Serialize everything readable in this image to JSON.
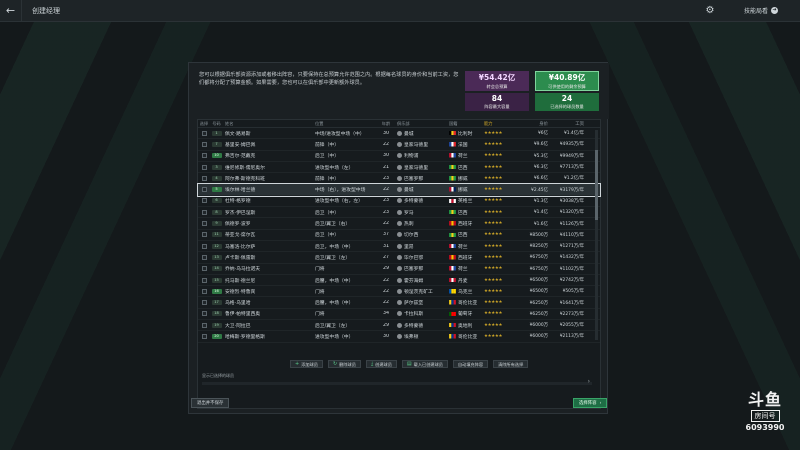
{
  "topbar": {
    "title": "创建经理",
    "link_label": "技能局看",
    "link_icon": "circle-arrow-icon"
  },
  "intro": "您可以根据俱乐部资源添加或者移出阵容，只要保持在总预算允许范围之内。根据每名球员的身价和当前工资，您们都将分配了预算金额。如果需要，您也可以在俱乐部中更新额外球员。",
  "stats": {
    "transfer": {
      "value": "¥54.42亿",
      "label": "转会总预算"
    },
    "wage": {
      "value": "¥40.89亿",
      "label": "可供使用的剩余预算"
    },
    "count1": {
      "value": "84",
      "label": "阵容最大容量"
    },
    "count2": {
      "value": "24",
      "label": "已选择的球员数量"
    }
  },
  "table": {
    "headers": [
      "选择",
      "号码",
      "姓名",
      "位置",
      "年龄",
      "俱乐部",
      "国籍",
      "能力",
      "身价",
      "工资"
    ],
    "rows": [
      {
        "num": "1",
        "name": "佩文·路易斯",
        "pos": "中场/进攻型中场（中）",
        "age": "30",
        "club": "曼城",
        "nat": "比利时",
        "flag": [
          "#000",
          "#f5d11a",
          "#e5262c"
        ],
        "stars": "★★★★★",
        "val": "¥6亿",
        "wage": "¥1.4亿/年"
      },
      {
        "num": "7",
        "name": "基里安·姆巴佩",
        "pos": "前锋（中）",
        "age": "22",
        "club": "皇家马德里",
        "nat": "法国",
        "flag": [
          "#1f4aa8",
          "#fff",
          "#e5262c"
        ],
        "stars": "★★★★★",
        "val": "¥9.6亿",
        "wage": "¥4935万/年"
      },
      {
        "num": "10",
        "name": "弗吉尔·范戴克",
        "pos": "后卫（中）",
        "age": "30",
        "club": "利物浦",
        "nat": "荷兰",
        "flag": [
          "#c8102e",
          "#fff",
          "#1f4aa8"
        ],
        "stars": "★★★★★",
        "val": "¥5.3亿",
        "wage": "¥9949万/年"
      },
      {
        "num": "3",
        "name": "维尼修斯·儒尼奥尔",
        "pos": "进攻型中场（左）",
        "age": "21",
        "club": "皇家马德里",
        "nat": "巴西",
        "flag": [
          "#229e45",
          "#f5d11a",
          "#229e45"
        ],
        "stars": "★★★★★",
        "val": "¥6.3亿",
        "wage": "¥7713万/年"
      },
      {
        "num": "4",
        "name": "阿尔弗·斯德克科班",
        "pos": "前锋（中）",
        "age": "23",
        "club": "巴塞罗那",
        "nat": "挪威",
        "flag": [
          "#229e45",
          "#f5d11a",
          "#229e45"
        ],
        "stars": "★★★★★",
        "val": "¥6.6亿",
        "wage": "¥1.2亿/年"
      },
      {
        "num": "5",
        "name": "埃尔林·哈兰德",
        "pos": "中场（右），进攻型中场",
        "age": "22",
        "club": "曼城",
        "nat": "挪威",
        "flag": [
          "#ba0c2f",
          "#fff",
          "#00205b"
        ],
        "stars": "★★★★★",
        "val": "¥2.45亿",
        "wage": "¥3179万/年"
      },
      {
        "num": "6",
        "name": "杜特·格罗德",
        "pos": "进攻型中场（右，左）",
        "age": "23",
        "club": "多特蒙德",
        "nat": "英格兰",
        "flag": [
          "#fff",
          "#c8102e",
          "#fff"
        ],
        "stars": "★★★★★",
        "val": "¥1.3亿",
        "wage": "¥3038万/年"
      },
      {
        "num": "8",
        "name": "罗杰·伊巴涅斯",
        "pos": "后卫（中）",
        "age": "23",
        "club": "罗马",
        "nat": "巴西",
        "flag": [
          "#229e45",
          "#f5d11a",
          "#229e45"
        ],
        "stars": "★★★★★",
        "val": "¥1.4亿",
        "wage": "¥1320万/年"
      },
      {
        "num": "9",
        "name": "佩德罗·波罗",
        "pos": "后卫/翼卫（右）",
        "age": "22",
        "club": "热刺",
        "nat": "西班牙",
        "flag": [
          "#c60b1e",
          "#ffc400",
          "#c60b1e"
        ],
        "stars": "★★★★★",
        "val": "¥1.6亿",
        "wage": "¥1126万/年"
      },
      {
        "num": "11",
        "name": "蒂亚戈·席尔瓦",
        "pos": "后卫（中）",
        "age": "37",
        "club": "切尔西",
        "nat": "巴西",
        "flag": [
          "#229e45",
          "#f5d11a",
          "#229e45"
        ],
        "stars": "★★★★★",
        "val": "¥8500万",
        "wage": "¥4110万/年"
      },
      {
        "num": "12",
        "name": "马塞洛·比尔萨",
        "pos": "后卫，中场（中）",
        "age": "31",
        "club": "里昂",
        "nat": "荷兰",
        "flag": [
          "#c8102e",
          "#fff",
          "#1f4aa8"
        ],
        "stars": "★★★★★",
        "val": "¥8250万",
        "wage": "¥1271万/年"
      },
      {
        "num": "13",
        "name": "卢卡斯·佩雷斯",
        "pos": "后卫/翼卫（左）",
        "age": "27",
        "club": "毕尔巴鄂",
        "nat": "西班牙",
        "flag": [
          "#c60b1e",
          "#ffc400",
          "#c60b1e"
        ],
        "stars": "★★★★★",
        "val": "¥6750万",
        "wage": "¥1432万/年"
      },
      {
        "num": "14",
        "name": "乔纳·乌马拉诺夫",
        "pos": "门将",
        "age": "29",
        "club": "巴塞罗那",
        "nat": "荷兰",
        "flag": [
          "#c8102e",
          "#fff",
          "#1f4aa8"
        ],
        "stars": "★★★★★",
        "val": "¥6750万",
        "wage": "¥1102万/年"
      },
      {
        "num": "15",
        "name": "托马斯·德兰尼",
        "pos": "后腰，中场（中）",
        "age": "22",
        "club": "霍芬海姆",
        "nat": "丹麦",
        "flag": [
          "#c8102e",
          "#fff",
          "#c8102e"
        ],
        "stars": "★★★★★",
        "val": "¥6500万",
        "wage": "¥2742万/年"
      },
      {
        "num": "16",
        "name": "安德烈·特鲁宾",
        "pos": "门将",
        "age": "22",
        "club": "顿涅茨克矿工",
        "nat": "乌克兰",
        "flag": [
          "#0057b7",
          "#ffd700",
          "#ffd700"
        ],
        "stars": "★★★★★",
        "val": "¥6500万",
        "wage": "¥505万/年"
      },
      {
        "num": "17",
        "name": "乌格·乌里哈",
        "pos": "后腰，中场（中）",
        "age": "22",
        "club": "萨尔兹堡",
        "nat": "哥伦比亚",
        "flag": [
          "#fcd116",
          "#003893",
          "#ce1126"
        ],
        "stars": "★★★★★",
        "val": "¥6250万",
        "wage": "¥1641万/年"
      },
      {
        "num": "18",
        "name": "鲁伊·帕特里西奥",
        "pos": "门将",
        "age": "34",
        "club": "卡拉科斯",
        "nat": "葡萄牙",
        "flag": [
          "#006600",
          "#ff0000",
          "#ff0000"
        ],
        "stars": "★★★★★",
        "val": "¥6250万",
        "wage": "¥2273万/年"
      },
      {
        "num": "19",
        "name": "大卫·阿拉巴",
        "pos": "后卫/翼卫（左）",
        "age": "29",
        "club": "多特蒙德",
        "nat": "奥地利",
        "flag": [
          "#fcd116",
          "#003893",
          "#ce1126"
        ],
        "stars": "★★★★★",
        "val": "¥6000万",
        "wage": "¥2055万/年"
      },
      {
        "num": "20",
        "name": "哈梅斯·罗德里格斯",
        "pos": "进攻型中场（中）",
        "age": "30",
        "club": "埃弗顿",
        "nat": "哥伦比亚",
        "flag": [
          "#fcd116",
          "#003893",
          "#ce1126"
        ],
        "stars": "★★★★★",
        "val": "¥6000万",
        "wage": "¥2113万/年"
      }
    ]
  },
  "actions": [
    {
      "icon": "plus-icon",
      "label": "添加球员"
    },
    {
      "icon": "refresh-icon",
      "label": "删除球员"
    },
    {
      "icon": "download-icon",
      "label": "创建球员"
    },
    {
      "icon": "folder-icon",
      "label": "载入已创建球员"
    },
    {
      "icon": "",
      "label": "自动填充阵容"
    },
    {
      "icon": "",
      "label": "清除所有选择"
    }
  ],
  "filter_label": "显示已选择的球员",
  "buttons": {
    "cancel": "退出并不保存",
    "next": "选择阵容"
  },
  "watermark": {
    "logo": "斗鱼",
    "tag": "房间号",
    "id": "6093990"
  },
  "colors": {
    "accent_green": "#2c8c4e",
    "accent_purple": "#4b2a57",
    "star": "#c9a227"
  }
}
